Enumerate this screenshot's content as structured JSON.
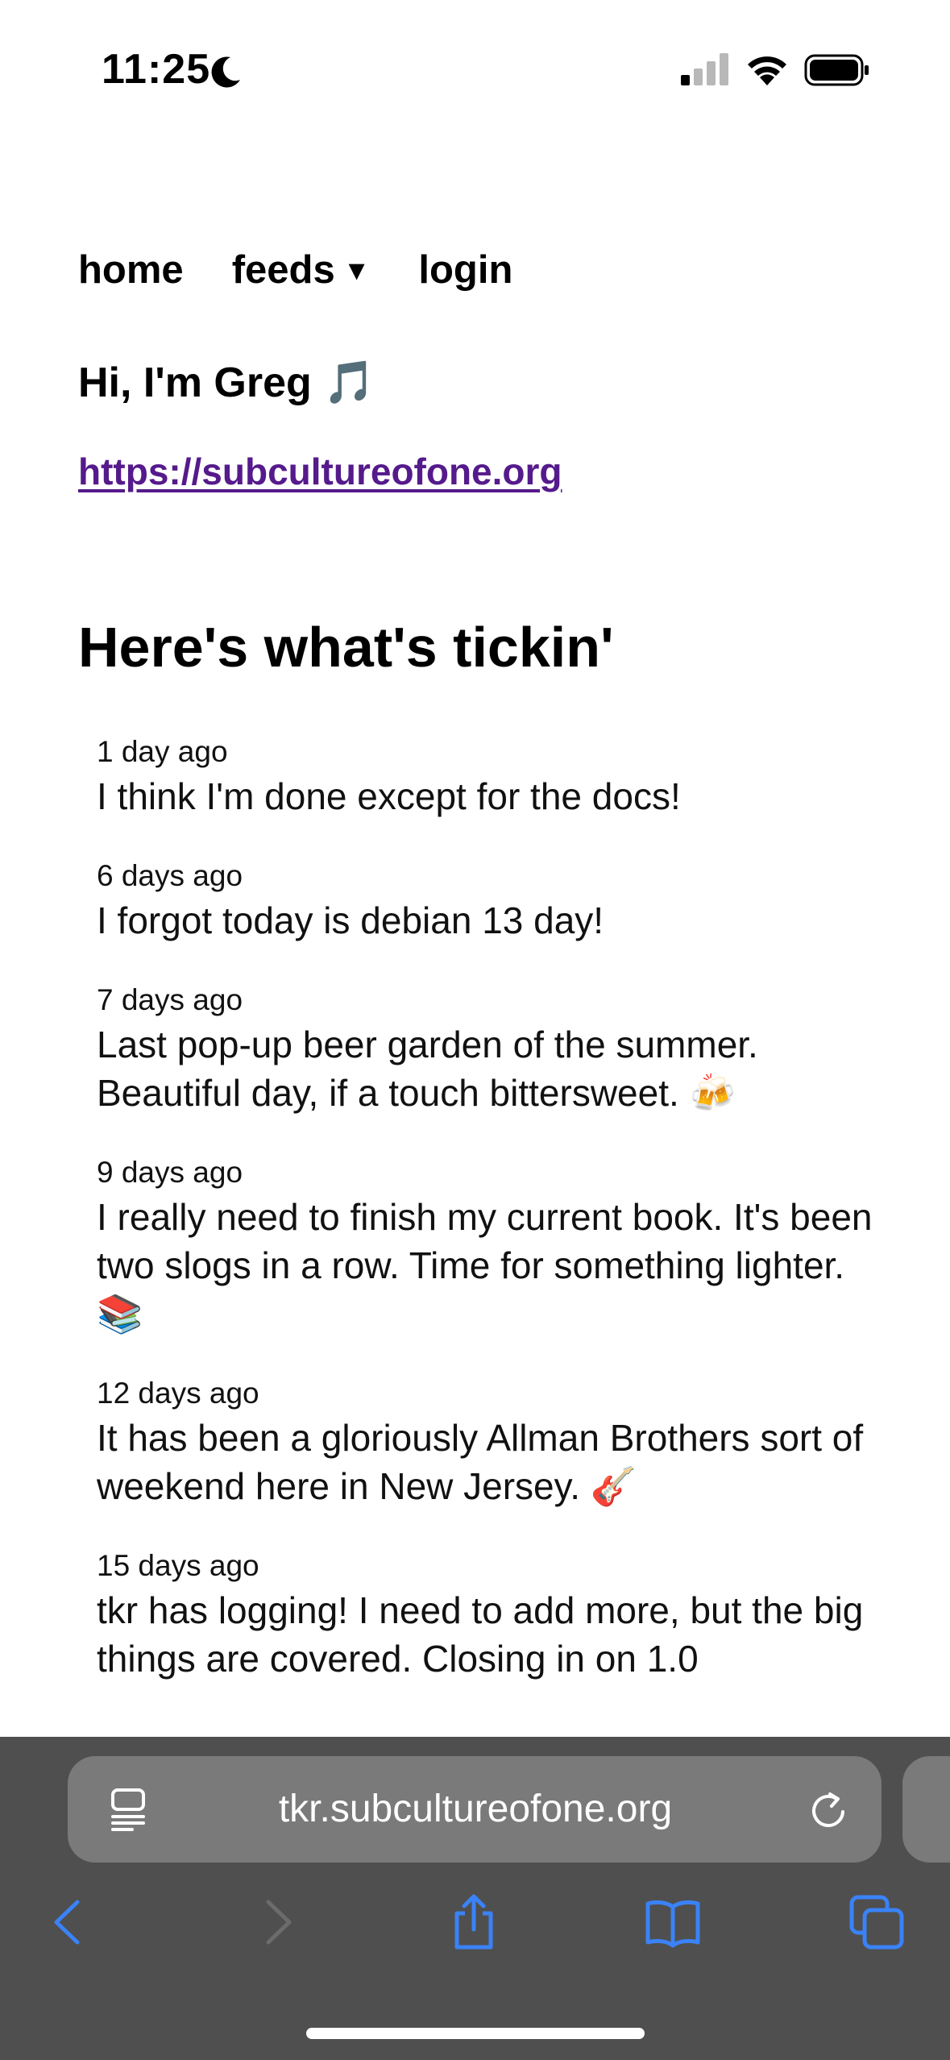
{
  "status_bar": {
    "time": "11:25"
  },
  "nav": {
    "items": [
      {
        "label": "home"
      },
      {
        "label": "feeds",
        "caret": "▼"
      },
      {
        "label": "login"
      }
    ]
  },
  "profile": {
    "greeting": "Hi, I'm Greg 🎵",
    "link": "https://subcultureofone.org"
  },
  "section": {
    "title": "Here's what's tickin'"
  },
  "feed": [
    {
      "time": "1 day ago",
      "text": "I think I'm done except for the docs!"
    },
    {
      "time": "6 days ago",
      "text": "I forgot today is debian 13 day!"
    },
    {
      "time": "7 days ago",
      "text": "Last pop-up beer garden of the summer. Beautiful day, if a touch bittersweet. 🍻"
    },
    {
      "time": "9 days ago",
      "text": "I really need to finish my current book. It's been two slogs in a row. Time for something lighter. 📚"
    },
    {
      "time": "12 days ago",
      "text": "It has been a gloriously Allman Brothers sort of weekend here in New Jersey. 🎸"
    },
    {
      "time": "15 days ago",
      "text": "tkr has logging! I need to add more, but the big things are covered. Closing in on 1.0"
    }
  ],
  "browser": {
    "url": "tkr.subcultureofone.org",
    "accent_color": "#3a82f7",
    "toolbar_color": "#4f4f4f",
    "icons": [
      "reader-icon",
      "reload-icon",
      "back-icon",
      "forward-icon",
      "share-icon",
      "bookmarks-icon",
      "tabs-icon"
    ]
  },
  "colors": {
    "link_visited": "#551a8b",
    "text": "#000000"
  }
}
